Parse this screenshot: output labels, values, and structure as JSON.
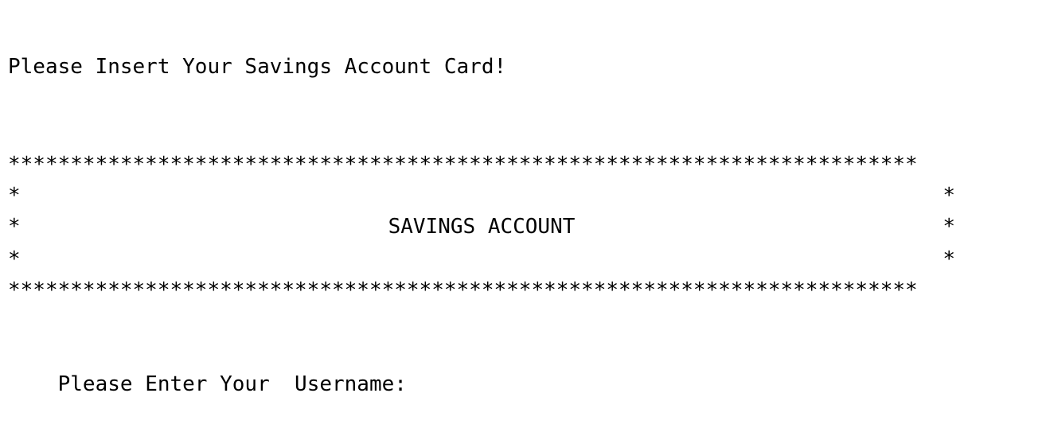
{
  "terminal": {
    "insert_card_prompt": "Please Insert Your Savings Account Card!",
    "banner": {
      "border": "*************************************************************************",
      "border_char": "*",
      "title": "SAVINGS ACCOUNT"
    },
    "username_prompt": "Please Enter Your  Username:"
  }
}
